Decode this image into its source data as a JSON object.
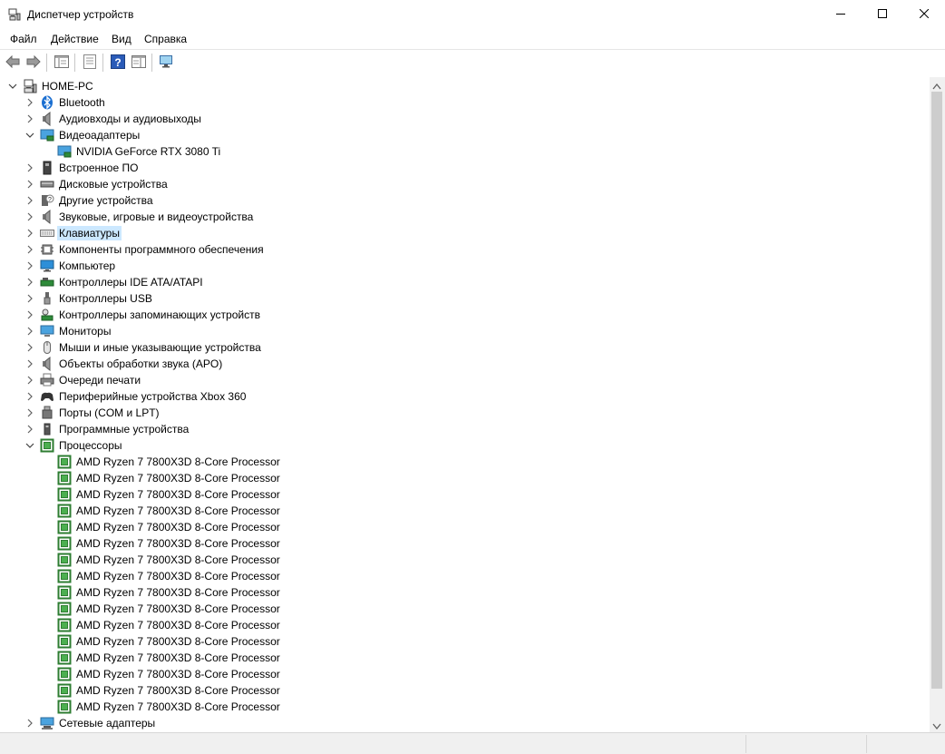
{
  "window": {
    "title": "Диспетчер устройств",
    "minimize_icon": "minimize-icon",
    "maximize_icon": "maximize-icon",
    "close_icon": "close-icon"
  },
  "menu": {
    "items": [
      "Файл",
      "Действие",
      "Вид",
      "Справка"
    ]
  },
  "toolbar": {
    "buttons": [
      "back-arrow-icon",
      "forward-arrow-icon",
      "show-hide-console-tree-icon",
      "properties-icon",
      "help-icon",
      "action-pane-icon",
      "scan-hardware-icon"
    ]
  },
  "tree": {
    "root": "HOME-PC",
    "selected": "Клавиатуры",
    "categories": [
      {
        "label": "Bluetooth",
        "icon": "bluetooth-icon",
        "expanded": false
      },
      {
        "label": "Аудиовходы и аудиовыходы",
        "icon": "speaker-icon",
        "expanded": false
      },
      {
        "label": "Видеоадаптеры",
        "icon": "display-adapter-icon",
        "expanded": true,
        "children": [
          "NVIDIA GeForce RTX 3080 Ti"
        ]
      },
      {
        "label": "Встроенное ПО",
        "icon": "firmware-icon",
        "expanded": false
      },
      {
        "label": "Дисковые устройства",
        "icon": "disk-drive-icon",
        "expanded": false
      },
      {
        "label": "Другие устройства",
        "icon": "unknown-device-icon",
        "expanded": false
      },
      {
        "label": "Звуковые, игровые и видеоустройства",
        "icon": "sound-icon",
        "expanded": false
      },
      {
        "label": "Клавиатуры",
        "icon": "keyboard-icon",
        "expanded": false
      },
      {
        "label": "Компоненты программного обеспечения",
        "icon": "software-component-icon",
        "expanded": false
      },
      {
        "label": "Компьютер",
        "icon": "computer-icon",
        "expanded": false
      },
      {
        "label": "Контроллеры IDE ATA/ATAPI",
        "icon": "ide-controller-icon",
        "expanded": false
      },
      {
        "label": "Контроллеры USB",
        "icon": "usb-icon",
        "expanded": false
      },
      {
        "label": "Контроллеры запоминающих устройств",
        "icon": "storage-controller-icon",
        "expanded": false
      },
      {
        "label": "Мониторы",
        "icon": "monitor-icon",
        "expanded": false
      },
      {
        "label": "Мыши и иные указывающие устройства",
        "icon": "mouse-icon",
        "expanded": false
      },
      {
        "label": "Объекты обработки звука (APO)",
        "icon": "apo-icon",
        "expanded": false
      },
      {
        "label": "Очереди печати",
        "icon": "printer-icon",
        "expanded": false
      },
      {
        "label": "Периферийные устройства Xbox 360",
        "icon": "gamepad-icon",
        "expanded": false
      },
      {
        "label": "Порты (COM и LPT)",
        "icon": "port-icon",
        "expanded": false
      },
      {
        "label": "Программные устройства",
        "icon": "software-device-icon",
        "expanded": false
      },
      {
        "label": "Процессоры",
        "icon": "processor-icon",
        "expanded": true,
        "children": [
          "AMD Ryzen 7 7800X3D 8-Core Processor",
          "AMD Ryzen 7 7800X3D 8-Core Processor",
          "AMD Ryzen 7 7800X3D 8-Core Processor",
          "AMD Ryzen 7 7800X3D 8-Core Processor",
          "AMD Ryzen 7 7800X3D 8-Core Processor",
          "AMD Ryzen 7 7800X3D 8-Core Processor",
          "AMD Ryzen 7 7800X3D 8-Core Processor",
          "AMD Ryzen 7 7800X3D 8-Core Processor",
          "AMD Ryzen 7 7800X3D 8-Core Processor",
          "AMD Ryzen 7 7800X3D 8-Core Processor",
          "AMD Ryzen 7 7800X3D 8-Core Processor",
          "AMD Ryzen 7 7800X3D 8-Core Processor",
          "AMD Ryzen 7 7800X3D 8-Core Processor",
          "AMD Ryzen 7 7800X3D 8-Core Processor",
          "AMD Ryzen 7 7800X3D 8-Core Processor",
          "AMD Ryzen 7 7800X3D 8-Core Processor"
        ]
      },
      {
        "label": "Сетевые адаптеры",
        "icon": "network-adapter-icon",
        "expanded": false
      }
    ]
  },
  "colors": {
    "selection": "#cce8ff",
    "scrollbar_track": "#f0f0f0",
    "scrollbar_thumb": "#cdcdcd"
  }
}
